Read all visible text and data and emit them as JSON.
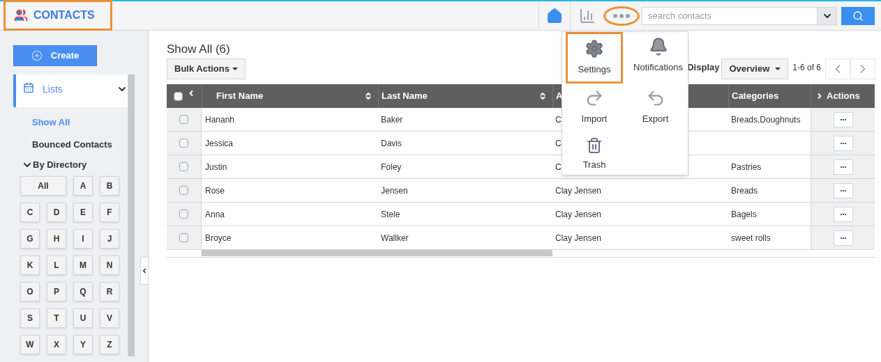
{
  "header": {
    "app_title": "CONTACTS",
    "title_highlighted": true,
    "more_highlighted": true,
    "search": {
      "placeholder": "search contacts"
    }
  },
  "sidebar": {
    "create_button": "Create",
    "lists": {
      "label": "Lists",
      "expanded": true
    },
    "items": [
      {
        "label": "Show All",
        "selected": true
      },
      {
        "label": "Bounced Contacts",
        "selected": false
      }
    ],
    "directory": {
      "label": "By Directory",
      "expanded": true,
      "letters": [
        "All",
        "A",
        "B",
        "C",
        "D",
        "E",
        "F",
        "G",
        "H",
        "I",
        "J",
        "K",
        "L",
        "M",
        "N",
        "O",
        "P",
        "Q",
        "R",
        "S",
        "T",
        "U",
        "V",
        "W",
        "X",
        "Y",
        "Z"
      ]
    }
  },
  "main": {
    "title": "Show All (6)",
    "bulk_actions": "Bulk Actions",
    "display_label": "Display",
    "display_value": "Overview",
    "pagination": "1-6 of 6",
    "table": {
      "header_checked": false,
      "columns": [
        "First Name",
        "Last Name",
        "A",
        "Categories",
        "Actions"
      ],
      "rows": [
        {
          "checked": false,
          "cells": [
            "Hananh",
            "Baker",
            "C",
            "Breads,Doughnuts"
          ]
        },
        {
          "checked": false,
          "cells": [
            "Jessica",
            "Davis",
            "C",
            ""
          ]
        },
        {
          "checked": false,
          "cells": [
            "Justin",
            "Foley",
            "C",
            "Pastries"
          ]
        },
        {
          "checked": false,
          "cells": [
            "Rose",
            "Jensen",
            "Clay Jensen",
            "Breads"
          ]
        },
        {
          "checked": false,
          "cells": [
            "Anna",
            "Stele",
            "Clay Jensen",
            "Bagels"
          ]
        },
        {
          "checked": false,
          "cells": [
            "Broyce",
            "Wallker",
            "Clay Jensen",
            "sweet rolls"
          ]
        }
      ]
    }
  },
  "menu": {
    "items": [
      {
        "kind": "settings",
        "label": "Settings",
        "highlighted": true
      },
      {
        "kind": "notifications",
        "label": "Notifications",
        "highlighted": false
      },
      {
        "kind": "import",
        "label": "Import",
        "highlighted": false
      },
      {
        "kind": "export",
        "label": "Export",
        "highlighted": false
      },
      {
        "kind": "trash",
        "label": "Trash",
        "highlighted": false
      }
    ]
  }
}
